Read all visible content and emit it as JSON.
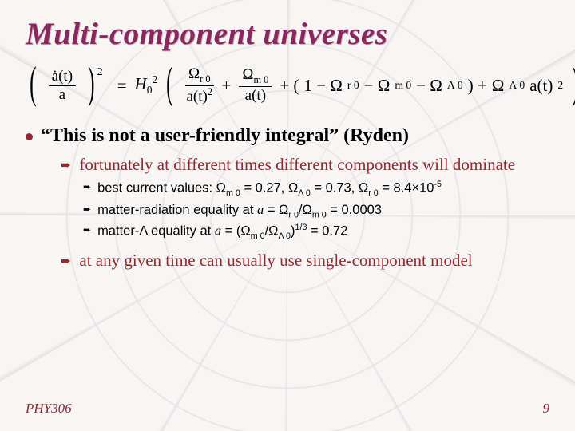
{
  "title": "Multi-component universes",
  "main_point": "“This is not a user-friendly integral” (Ryden)",
  "sub1": "fortunately at different times different components will dominate",
  "subsub1_pre": "best current values: Ω",
  "subsub1_m0": "m 0",
  "subsub1_v1": " = 0.27, Ω",
  "subsub1_l0": "Λ 0",
  "subsub1_v2": " = 0.73, Ω",
  "subsub1_r0": "r 0",
  "subsub1_v3": " = 8.4×10",
  "subsub1_exp": "-5",
  "subsub2_pre": "matter-radiation equality at ",
  "subsub2_var": "a",
  "subsub2_mid": " = Ω",
  "subsub2_r0": "r 0",
  "subsub2_div": "/Ω",
  "subsub2_m0": "m 0",
  "subsub2_end": " = 0.0003",
  "subsub3_pre": "matter-Λ equality at ",
  "subsub3_var": "a",
  "subsub3_mid": " = (Ω",
  "subsub3_m0": "m 0",
  "subsub3_div": "/Ω",
  "subsub3_l0": "Λ 0",
  "subsub3_close": ")",
  "subsub3_exp": "1/3",
  "subsub3_end": " = 0.72",
  "sub2": "at any given time can usually use single-component model",
  "course": "PHY306",
  "page": "9",
  "eq": {
    "lhs_num": "ȧ(t)",
    "lhs_den": "a",
    "rhs_H": "H",
    "rhs_H_sub": "0",
    "rhs_H_sup": "2",
    "t1_num": "Ω",
    "t1_num_sub": "r 0",
    "t1_den": "a(t)",
    "t1_den_sup": "2",
    "t2_num": "Ω",
    "t2_num_sub": "m 0",
    "t2_den": "a(t)",
    "t3_a": "1 − Ω",
    "t3_r": "r 0",
    "t3_b": " − Ω",
    "t3_m": "m 0",
    "t3_c": " − Ω",
    "t3_l": "Λ 0",
    "t4_a": "Ω",
    "t4_sub": "Λ 0",
    "t4_b": "a(t)",
    "t4_sup": "2"
  }
}
